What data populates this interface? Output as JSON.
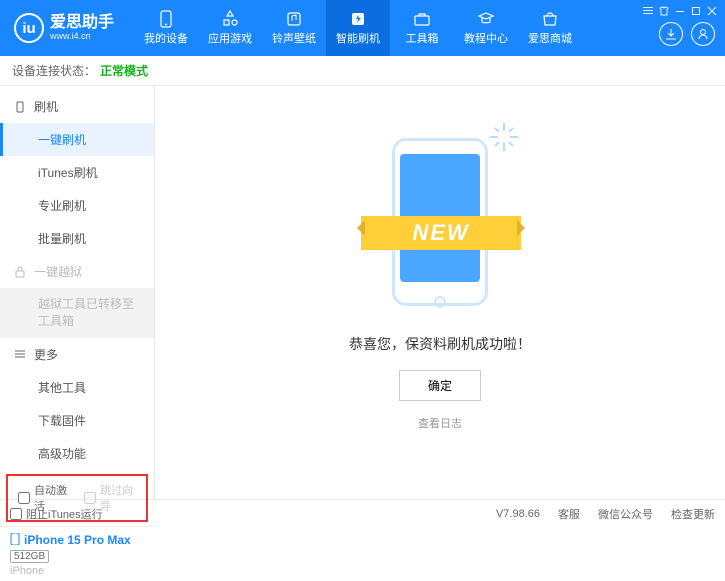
{
  "app": {
    "title": "爱思助手",
    "url": "www.i4.cn"
  },
  "nav": {
    "items": [
      {
        "label": "我的设备"
      },
      {
        "label": "应用游戏"
      },
      {
        "label": "铃声壁纸"
      },
      {
        "label": "智能刷机"
      },
      {
        "label": "工具箱"
      },
      {
        "label": "教程中心"
      },
      {
        "label": "爱思商城"
      }
    ],
    "active_index": 3
  },
  "status": {
    "label": "设备连接状态：",
    "value": "正常模式"
  },
  "sidebar": {
    "group_flash": "刷机",
    "items_flash": [
      "一键刷机",
      "iTunes刷机",
      "专业刷机",
      "批量刷机"
    ],
    "group_jailbreak": "一键越狱",
    "jailbreak_moved": "越狱工具已转移至工具箱",
    "group_more": "更多",
    "items_more": [
      "其他工具",
      "下载固件",
      "高级功能"
    ],
    "auto_activate": "自动激活",
    "skip_guide": "跳过向导"
  },
  "device": {
    "name": "iPhone 15 Pro Max",
    "storage": "512GB",
    "type": "iPhone"
  },
  "main": {
    "ribbon": "NEW",
    "message": "恭喜您，保资料刷机成功啦！",
    "ok": "确定",
    "log_link": "查看日志"
  },
  "footer": {
    "block_itunes": "阻止iTunes运行",
    "version": "V7.98.66",
    "support": "客服",
    "wechat": "微信公众号",
    "check_update": "检查更新"
  }
}
